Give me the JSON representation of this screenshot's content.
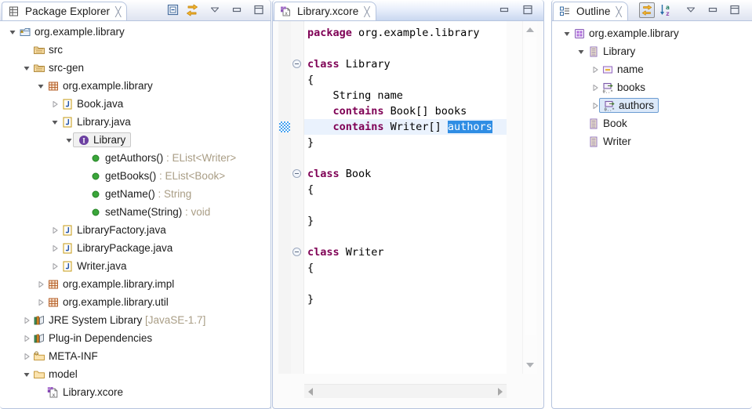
{
  "meta": {
    "app": "Eclipse IDE",
    "accent_blue": "#2f8de4",
    "tab_border": "#b6c4de",
    "keyword_color": "#7f0055",
    "dim_type_color": "#a99d85"
  },
  "package_explorer": {
    "tab_label": "Package Explorer",
    "tab_icon": "package-explorer-icon",
    "close_label": "╳",
    "toolbar": [
      {
        "name": "collapse-all-button",
        "icon": "collapse-all-icon"
      },
      {
        "name": "link-with-editor-button",
        "icon": "link-editor-icon"
      },
      {
        "name": "view-menu-button",
        "icon": "chevron-down-icon"
      },
      {
        "name": "minimize-button",
        "icon": "minimize-icon"
      },
      {
        "name": "maximize-button",
        "icon": "maximize-icon"
      }
    ],
    "tree": [
      {
        "indent": 0,
        "twisty": "expanded",
        "icon": "java-project-warning-icon",
        "label": "org.example.library",
        "selected": false
      },
      {
        "indent": 1,
        "twisty": "none",
        "icon": "source-folder-icon",
        "label": "src",
        "selected": false
      },
      {
        "indent": 1,
        "twisty": "expanded",
        "icon": "source-folder-icon",
        "label": "src-gen",
        "selected": false
      },
      {
        "indent": 2,
        "twisty": "expanded",
        "icon": "package-icon",
        "label": "org.example.library",
        "selected": false
      },
      {
        "indent": 3,
        "twisty": "collapsed",
        "icon": "java-file-icon",
        "label": "Book.java",
        "selected": false
      },
      {
        "indent": 3,
        "twisty": "expanded",
        "icon": "java-file-icon",
        "label": "Library.java",
        "selected": false
      },
      {
        "indent": 4,
        "twisty": "expanded",
        "icon": "interface-icon",
        "label": "Library",
        "selected": true
      },
      {
        "indent": 5,
        "twisty": "none",
        "icon": "method-public-icon",
        "label": "getAuthors()",
        "suffix": " : ",
        "type": "EList<Writer>",
        "selected": false
      },
      {
        "indent": 5,
        "twisty": "none",
        "icon": "method-public-icon",
        "label": "getBooks()",
        "suffix": " : ",
        "type": "EList<Book>",
        "selected": false
      },
      {
        "indent": 5,
        "twisty": "none",
        "icon": "method-public-icon",
        "label": "getName()",
        "suffix": " : ",
        "type": "String",
        "selected": false
      },
      {
        "indent": 5,
        "twisty": "none",
        "icon": "method-public-icon",
        "label": "setName(String)",
        "suffix": " : ",
        "type": "void",
        "selected": false
      },
      {
        "indent": 3,
        "twisty": "collapsed",
        "icon": "java-file-icon",
        "label": "LibraryFactory.java",
        "selected": false
      },
      {
        "indent": 3,
        "twisty": "collapsed",
        "icon": "java-file-icon",
        "label": "LibraryPackage.java",
        "selected": false
      },
      {
        "indent": 3,
        "twisty": "collapsed",
        "icon": "java-file-icon",
        "label": "Writer.java",
        "selected": false
      },
      {
        "indent": 2,
        "twisty": "collapsed",
        "icon": "package-icon",
        "label": "org.example.library.impl",
        "selected": false
      },
      {
        "indent": 2,
        "twisty": "collapsed",
        "icon": "package-icon",
        "label": "org.example.library.util",
        "selected": false
      },
      {
        "indent": 1,
        "twisty": "collapsed",
        "icon": "library-icon",
        "label": "JRE System Library",
        "suffix": " ",
        "type": "[JavaSE-1.7]",
        "selected": false
      },
      {
        "indent": 1,
        "twisty": "collapsed",
        "icon": "library-icon",
        "label": "Plug-in Dependencies",
        "selected": false
      },
      {
        "indent": 1,
        "twisty": "collapsed",
        "icon": "meta-folder-icon",
        "label": "META-INF",
        "selected": false
      },
      {
        "indent": 1,
        "twisty": "expanded",
        "icon": "folder-icon",
        "label": "model",
        "selected": false
      },
      {
        "indent": 2,
        "twisty": "none",
        "icon": "xcore-file-icon",
        "label": "Library.xcore",
        "selected": false
      }
    ]
  },
  "editor": {
    "tab_label": "Library.xcore",
    "tab_icon": "xcore-file-icon",
    "close_label": "╳",
    "toolbar": [
      {
        "name": "minimize-button",
        "icon": "minimize-icon"
      },
      {
        "name": "maximize-button",
        "icon": "maximize-icon"
      }
    ],
    "selected_word": "authors",
    "highlighted_line_index": 6,
    "fold_line_indices": [
      2,
      9,
      14
    ],
    "lines": [
      {
        "indent": 0,
        "tokens": [
          {
            "t": "package",
            "k": true
          },
          {
            "t": " org.example.library",
            "k": false
          }
        ]
      },
      {
        "indent": 0,
        "tokens": []
      },
      {
        "indent": 0,
        "tokens": [
          {
            "t": "class",
            "k": true
          },
          {
            "t": " Library",
            "k": false
          }
        ]
      },
      {
        "indent": 0,
        "tokens": [
          {
            "t": "{",
            "k": false
          }
        ]
      },
      {
        "indent": 1,
        "tokens": [
          {
            "t": "String name",
            "k": false
          }
        ]
      },
      {
        "indent": 1,
        "tokens": [
          {
            "t": "contains",
            "k": true
          },
          {
            "t": " Book[] books",
            "k": false
          }
        ]
      },
      {
        "indent": 1,
        "tokens": [
          {
            "t": "contains",
            "k": true
          },
          {
            "t": " Writer[] ",
            "k": false
          },
          {
            "t": "authors",
            "k": false,
            "sel": true
          }
        ]
      },
      {
        "indent": 0,
        "tokens": [
          {
            "t": "}",
            "k": false
          }
        ]
      },
      {
        "indent": 0,
        "tokens": []
      },
      {
        "indent": 0,
        "tokens": [
          {
            "t": "class",
            "k": true
          },
          {
            "t": " Book",
            "k": false
          }
        ]
      },
      {
        "indent": 0,
        "tokens": [
          {
            "t": "{",
            "k": false
          }
        ]
      },
      {
        "indent": 0,
        "tokens": []
      },
      {
        "indent": 0,
        "tokens": [
          {
            "t": "}",
            "k": false
          }
        ]
      },
      {
        "indent": 0,
        "tokens": []
      },
      {
        "indent": 0,
        "tokens": [
          {
            "t": "class",
            "k": true
          },
          {
            "t": " Writer",
            "k": false
          }
        ]
      },
      {
        "indent": 0,
        "tokens": [
          {
            "t": "{",
            "k": false
          }
        ]
      },
      {
        "indent": 0,
        "tokens": []
      },
      {
        "indent": 0,
        "tokens": [
          {
            "t": "}",
            "k": false
          }
        ]
      }
    ],
    "scroll": {
      "vertical_name": "editor-vertical-scrollbar",
      "horizontal_name": "editor-horizontal-scrollbar"
    }
  },
  "outline": {
    "tab_label": "Outline",
    "tab_icon": "outline-icon",
    "close_label": "╳",
    "toolbar": [
      {
        "name": "link-with-editor-button",
        "icon": "link-editor-icon",
        "pressed": true
      },
      {
        "name": "sort-button",
        "icon": "sort-az-icon"
      },
      {
        "name": "view-menu-button",
        "icon": "chevron-down-icon"
      },
      {
        "name": "minimize-button",
        "icon": "minimize-icon"
      },
      {
        "name": "maximize-button",
        "icon": "maximize-icon"
      }
    ],
    "tree": [
      {
        "indent": 0,
        "twisty": "expanded",
        "icon": "epackage-icon",
        "label": "org.example.library",
        "selected": false
      },
      {
        "indent": 1,
        "twisty": "expanded",
        "icon": "eclass-icon",
        "label": "Library",
        "selected": false
      },
      {
        "indent": 2,
        "twisty": "collapsed",
        "icon": "eattribute-icon",
        "label": "name",
        "selected": false
      },
      {
        "indent": 2,
        "twisty": "collapsed",
        "icon": "ereference-icon",
        "label": "books",
        "selected": false
      },
      {
        "indent": 2,
        "twisty": "collapsed",
        "icon": "ereference-icon",
        "label": "authors",
        "selected": true
      },
      {
        "indent": 1,
        "twisty": "none",
        "icon": "eclass-icon",
        "label": "Book",
        "selected": false
      },
      {
        "indent": 1,
        "twisty": "none",
        "icon": "eclass-icon",
        "label": "Writer",
        "selected": false
      }
    ]
  }
}
